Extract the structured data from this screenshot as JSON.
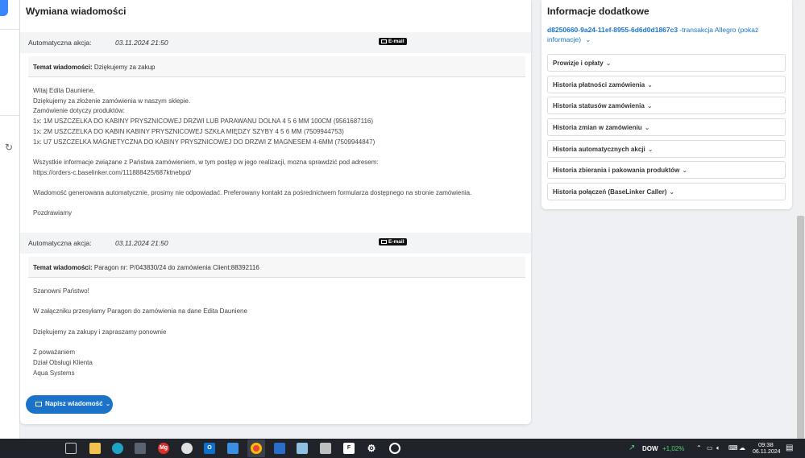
{
  "main": {
    "title": "Wymiana wiadomości",
    "messages": [
      {
        "action_label": "Automatyczna akcja:",
        "date": "03.11.2024 21:50",
        "badge": "E-mail",
        "subject_label": "Temat wiadomości:",
        "subject": "Dziękujemy za zakup",
        "lines": [
          "Witaj Edita Dauniene,",
          "Dziękujemy za złożenie zamówienia w naszym sklepie.",
          "Zamówienie dotyczy produktów:",
          "1x: 1M USZCZELKA DO KABINY PRYSZNICOWEJ DRZWI LUB PARAWANU DOLNA 4 5 6 MM 100CM (9561687116)",
          "1x: 2M USZCZELKA DO KABIN KABINY PRYSZNICOWEJ SZKŁA MIĘDZY SZYBY 4 5 6 MM (7509944753)",
          "1x: U7 USZCZELKA MAGNETYCZNA DO KABINY PRYSZNICOWEJ DO DRZWI Z MAGNESEM 4-6MM (7509944847)",
          "",
          "Wszystkie informacje związane z Państwa zamówieniem, w tym postęp w jego realizacji, mozna sprawdzić pod adresem:",
          "https://orders-c.baselinker.com/111888425/687ktnebpd/",
          "",
          "Wiadomość generowana automatycznie, prosimy nie odpowiadać. Preferowany kontakt za pośrednictwem formularza dostępnego na stronie zamówienia.",
          "",
          "Pozdrawiamy"
        ]
      },
      {
        "action_label": "Automatyczna akcja:",
        "date": "03.11.2024 21:50",
        "badge": "E-mail",
        "subject_label": "Temat wiadomości:",
        "subject": "Paragon nr: P/043830/24 do zamówienia Client:88392116",
        "lines": [
          "Szanowni Państwo!",
          "",
          "W załączniku przesyłamy Paragon do zamówienia na dane Edita Dauniene",
          "",
          "Dziękujemy za zakupy i zapraszamy ponownie",
          "",
          "Z poważaniem",
          "Dział Obsługi Klienta",
          "Aqua Systems"
        ]
      }
    ],
    "write_button": "Napisz wiadomość"
  },
  "side": {
    "title": "Informacje dodatkowe",
    "transaction_id": "d8250660-9a24-11ef-8955-6d6d0d1867c3",
    "transaction_text": "-transakcja Allegro (pokaż informacje)",
    "items": [
      "Prowizje i opłaty",
      "Historia płatności zamówienia",
      "Historia statusów zamówienia",
      "Historia zmian w zamówieniu",
      "Historia automatycznych akcji",
      "Historia zbierania i pakowania produktów",
      "Historia połączeń (BaseLinker Caller)"
    ]
  },
  "taskbar": {
    "ticker": "DOW",
    "change": "+1,02%",
    "time": "09:38",
    "date": "06.11.2024",
    "icons": [
      "task-view-icon",
      "file-explorer-icon",
      "edge-browser-icon",
      "calculator-icon",
      "mg-app-icon",
      "snip-icon",
      "outlook-icon",
      "calendar-icon",
      "chrome-icon",
      "image-app-icon",
      "notes-icon",
      "printer-icon",
      "f-app-icon",
      "settings-icon",
      "app-circle-icon"
    ]
  }
}
